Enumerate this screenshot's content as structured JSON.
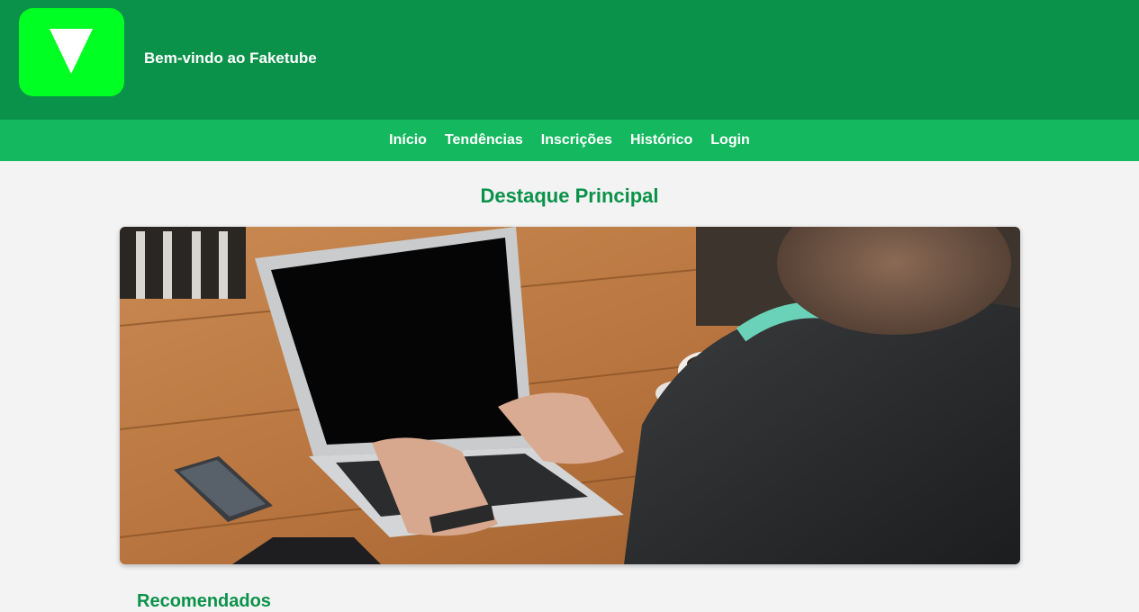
{
  "header": {
    "welcome_text": "Bem-vindo ao Faketube",
    "logo_icon": "play-triangle-icon",
    "logo_color": "#00ff22",
    "brand_color": "#0b924a"
  },
  "nav": {
    "items": [
      {
        "label": "Início"
      },
      {
        "label": "Tendências"
      },
      {
        "label": "Inscrições"
      },
      {
        "label": "Histórico"
      },
      {
        "label": "Login"
      }
    ],
    "background": "#14b85f"
  },
  "main": {
    "featured_title": "Destaque Principal",
    "hero_image": "person-typing-on-laptop-image",
    "next_section_title": "Recomendados"
  }
}
